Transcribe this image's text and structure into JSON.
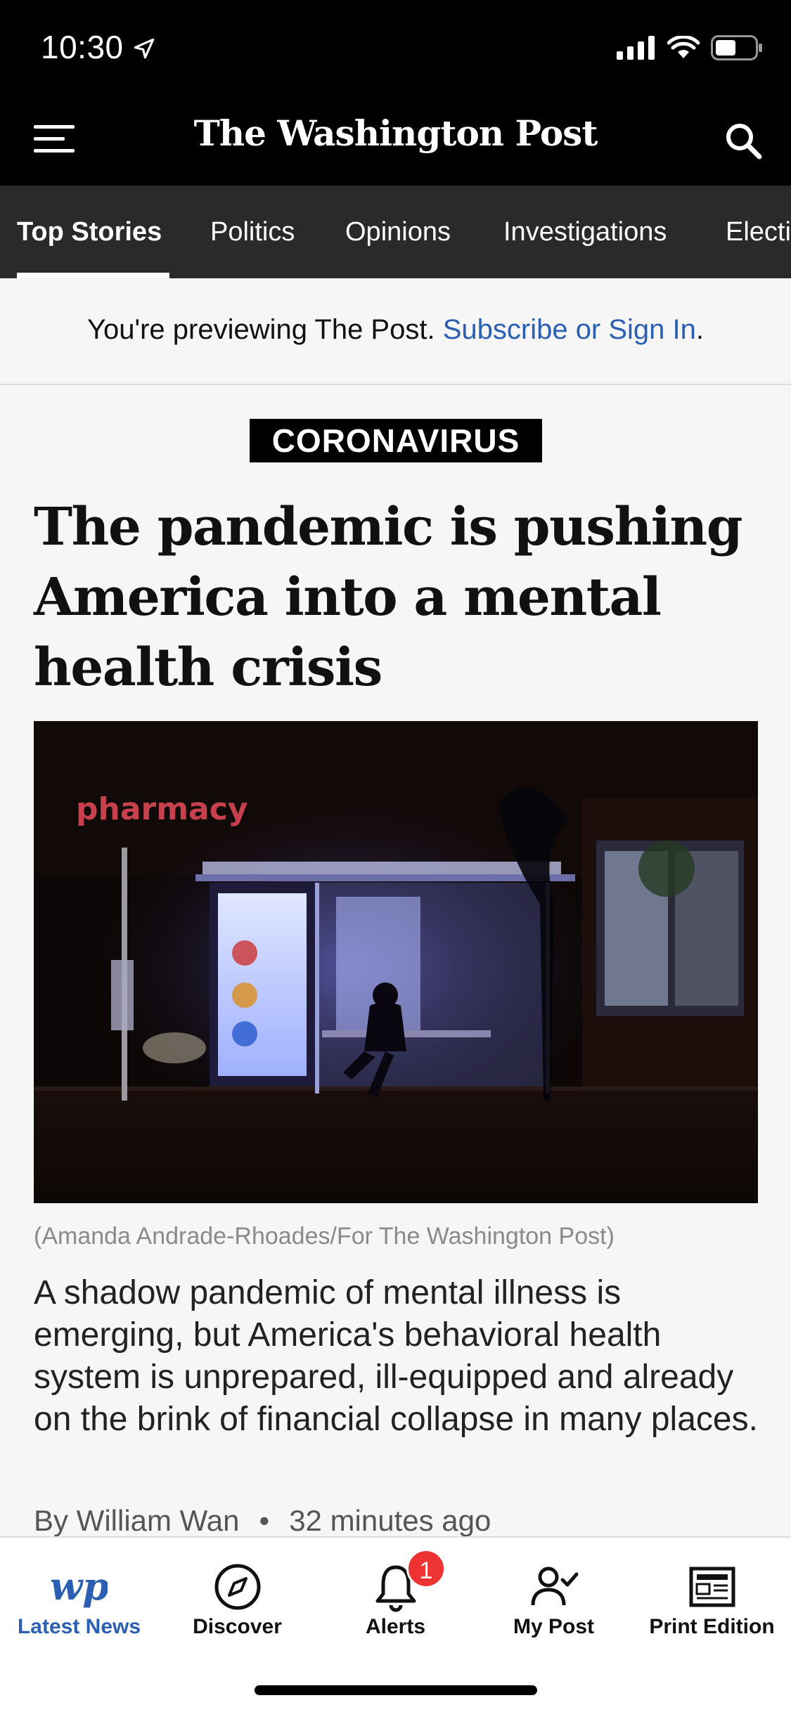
{
  "status_bar": {
    "time": "10:30"
  },
  "header": {
    "masthead": "The Washington Post"
  },
  "tabs": [
    {
      "label": "Top Stories"
    },
    {
      "label": "Politics"
    },
    {
      "label": "Opinions"
    },
    {
      "label": "Investigations"
    },
    {
      "label": "Electi"
    }
  ],
  "banner": {
    "text": "You're previewing The Post. ",
    "link": "Subscribe or Sign In",
    "end": "."
  },
  "article": {
    "kicker": "CORONAVIRUS",
    "headline": "The pandemic is pushing America into a mental health crisis",
    "photo_caption": "(Amanda Andrade-Rhoades/For The Washington Post)",
    "photo_sign": "pharmacy",
    "summary": "A shadow pandemic of mental illness is emerging, but America's behavioral health system is unprepared, ill-equipped and already on the brink of financial collapse in many places.",
    "byline": "By William Wan",
    "time_ago": "32 minutes ago"
  },
  "bottom_nav": {
    "latest_news": "Latest News",
    "discover": "Discover",
    "alerts": "Alerts",
    "alerts_badge": "1",
    "my_post": "My Post",
    "print_edition": "Print Edition"
  },
  "colors": {
    "link": "#2b5fb3",
    "badge": "#e33333"
  }
}
